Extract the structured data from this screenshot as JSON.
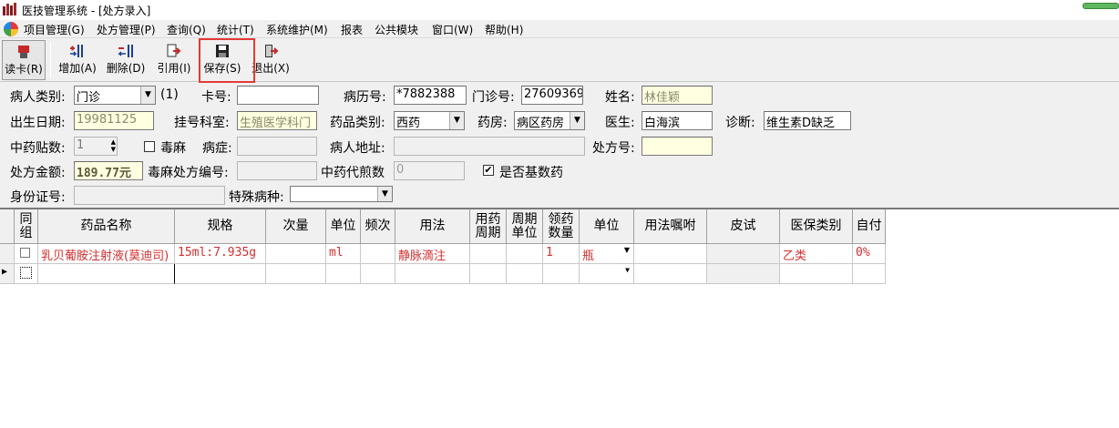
{
  "window": {
    "title": "医技管理系统 - [处方录入]"
  },
  "menu": [
    {
      "label": "项目管理(G)"
    },
    {
      "label": "处方管理(P)"
    },
    {
      "label": "查询(Q)"
    },
    {
      "label": "统计(T)"
    },
    {
      "label": "系统维护(M)"
    },
    {
      "label": "报表"
    },
    {
      "label": "公共模块"
    },
    {
      "label": "窗口(W)"
    },
    {
      "label": "帮助(H)"
    }
  ],
  "toolbar": {
    "read_card": "读卡(R)",
    "add": "增加(A)",
    "delete": "删除(D)",
    "cite": "引用(I)",
    "save": "保存(S)",
    "exit": "退出(X)"
  },
  "form": {
    "patient_type_label": "病人类别:",
    "patient_type_value": "门诊",
    "patient_type_code": "(1)",
    "card_no_label": "卡号:",
    "card_no_value": "",
    "record_no_label": "病历号:",
    "record_no_value": "*7882388",
    "clinic_no_label": "门诊号:",
    "clinic_no_value": "27609369",
    "name_label": "姓名:",
    "name_value": "林佳颖",
    "birth_label": "出生日期:",
    "birth_value": "19981125",
    "reg_dept_label": "挂号科室:",
    "reg_dept_value": "生殖医学科门",
    "drug_type_label": "药品类别:",
    "drug_type_value": "西药",
    "pharmacy_label": "药房:",
    "pharmacy_value": "病区药房",
    "doctor_label": "医生:",
    "doctor_value": "白海滨",
    "diagnosis_label": "诊断:",
    "diagnosis_value": "维生素D缺乏",
    "tcm_doses_label": "中药贴数:",
    "tcm_doses_value": "1",
    "narcotic_label": "毒麻",
    "disease_label": "病症:",
    "disease_value": "",
    "address_label": "病人地址:",
    "address_value": "",
    "rx_no_label": "处方号:",
    "rx_no_value": "",
    "amount_label": "处方金额:",
    "amount_value": "189.77元",
    "narcotic_rx_label": "毒麻处方编号:",
    "narcotic_rx_value": "",
    "decoct_label": "中药代煎数",
    "decoct_value": "0",
    "basic_drug_label": "是否基数药",
    "basic_drug_checked": "✔",
    "id_no_label": "身份证号:",
    "id_no_value": "",
    "special_label": "特殊病种:",
    "special_value": ""
  },
  "grid": {
    "headers": [
      "同\n组",
      "药品名称",
      "规格",
      "次量",
      "单位",
      "频次",
      "用法",
      "用药\n周期",
      "周期\n单位",
      "领药\n数量",
      "单位",
      "用法嘱咐",
      "皮试",
      "医保类别",
      "自付"
    ],
    "rows": [
      {
        "group": "",
        "drug_name": "乳贝葡胺注射液(莫迪司)",
        "spec": "15ml:7.935g",
        "dose": "",
        "dose_unit": "ml",
        "freq": "",
        "usage": "静脉滴注",
        "cycle": "",
        "cycle_unit": "",
        "qty": "1",
        "unit": "瓶",
        "instruction": "",
        "skin_test": "",
        "insurance": "乙类",
        "self_pay": "0%"
      }
    ]
  },
  "colors": {
    "accent_red": "#d32f2f",
    "highlight_box": "#e53935",
    "readonly_yellow": "#ffffe1"
  }
}
